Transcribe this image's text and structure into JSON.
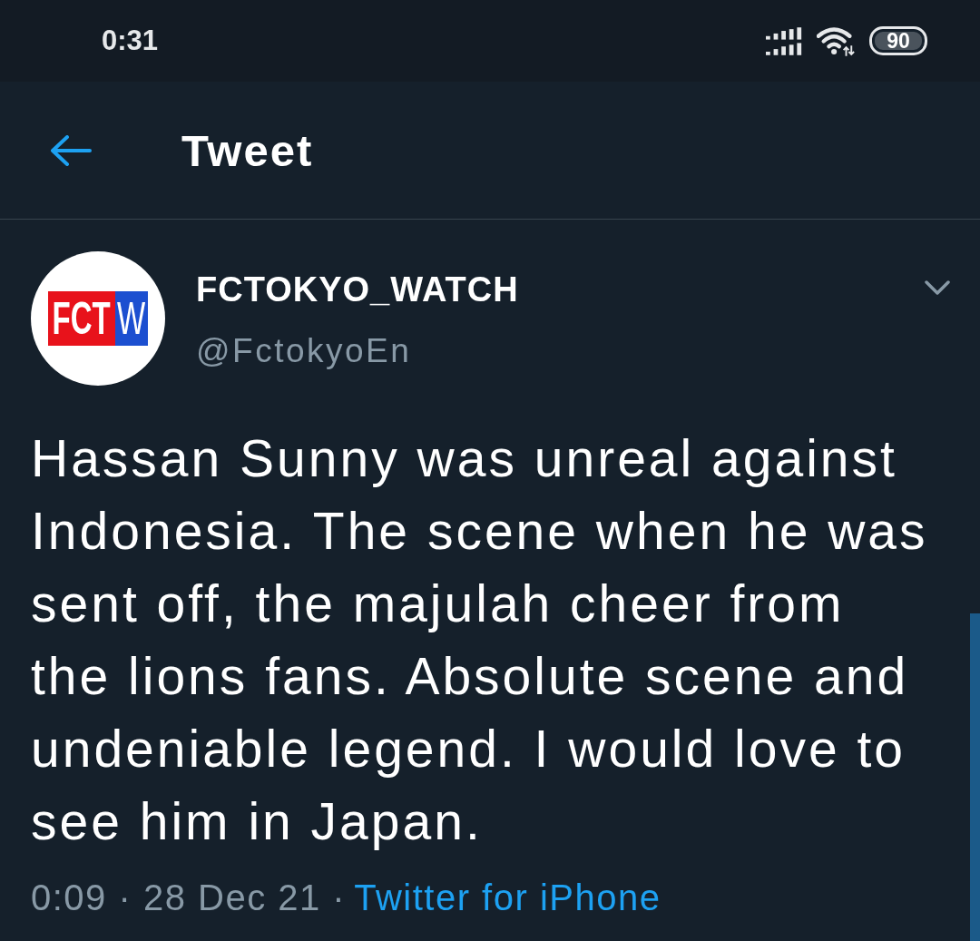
{
  "status_bar": {
    "time": "0:31",
    "battery": "90"
  },
  "header": {
    "title": "Tweet"
  },
  "tweet": {
    "avatar": {
      "logo_left": "FCT",
      "logo_right": "W"
    },
    "name": "FCTOKYO_WATCH",
    "handle": "@FctokyoEn",
    "text": "Hassan Sunny was unreal against Indonesia. The scene when he was sent off, the majulah cheer from the lions fans. Absolute scene and undeniable legend. I would love to see him in Japan.",
    "timestamp": "0:09 · 28 Dec 21 ·",
    "source": "Twitter for iPhone"
  }
}
